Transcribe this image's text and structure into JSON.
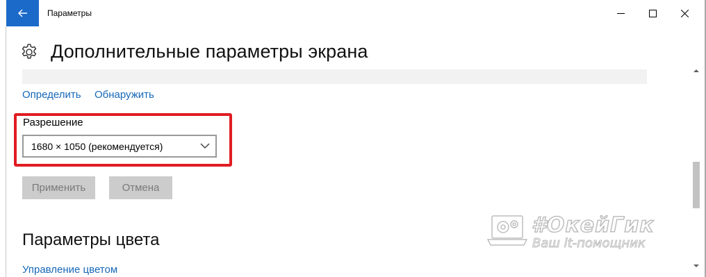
{
  "titlebar": {
    "title": "Параметры",
    "icons": {
      "back": "back-arrow-icon",
      "minimize": "minimize-icon",
      "maximize": "maximize-icon",
      "close": "close-icon"
    }
  },
  "header": {
    "icon": "gear-icon",
    "title": "Дополнительные параметры экрана"
  },
  "display": {
    "identify_link": "Определить",
    "detect_link": "Обнаружить"
  },
  "resolution": {
    "label": "Разрешение",
    "selected": "1680 × 1050 (рекомендуется)"
  },
  "buttons": {
    "apply": "Применить",
    "cancel": "Отмена"
  },
  "color": {
    "section_title": "Параметры цвета",
    "manage_link": "Управление цветом"
  },
  "watermark": {
    "brand": "#ОкейГик",
    "tagline": "Ваш it-помощник"
  },
  "colors": {
    "accent": "#1b6ac9",
    "link": "#1668b8",
    "highlight": "#e01c22",
    "disabled_button": "#cccccc"
  }
}
